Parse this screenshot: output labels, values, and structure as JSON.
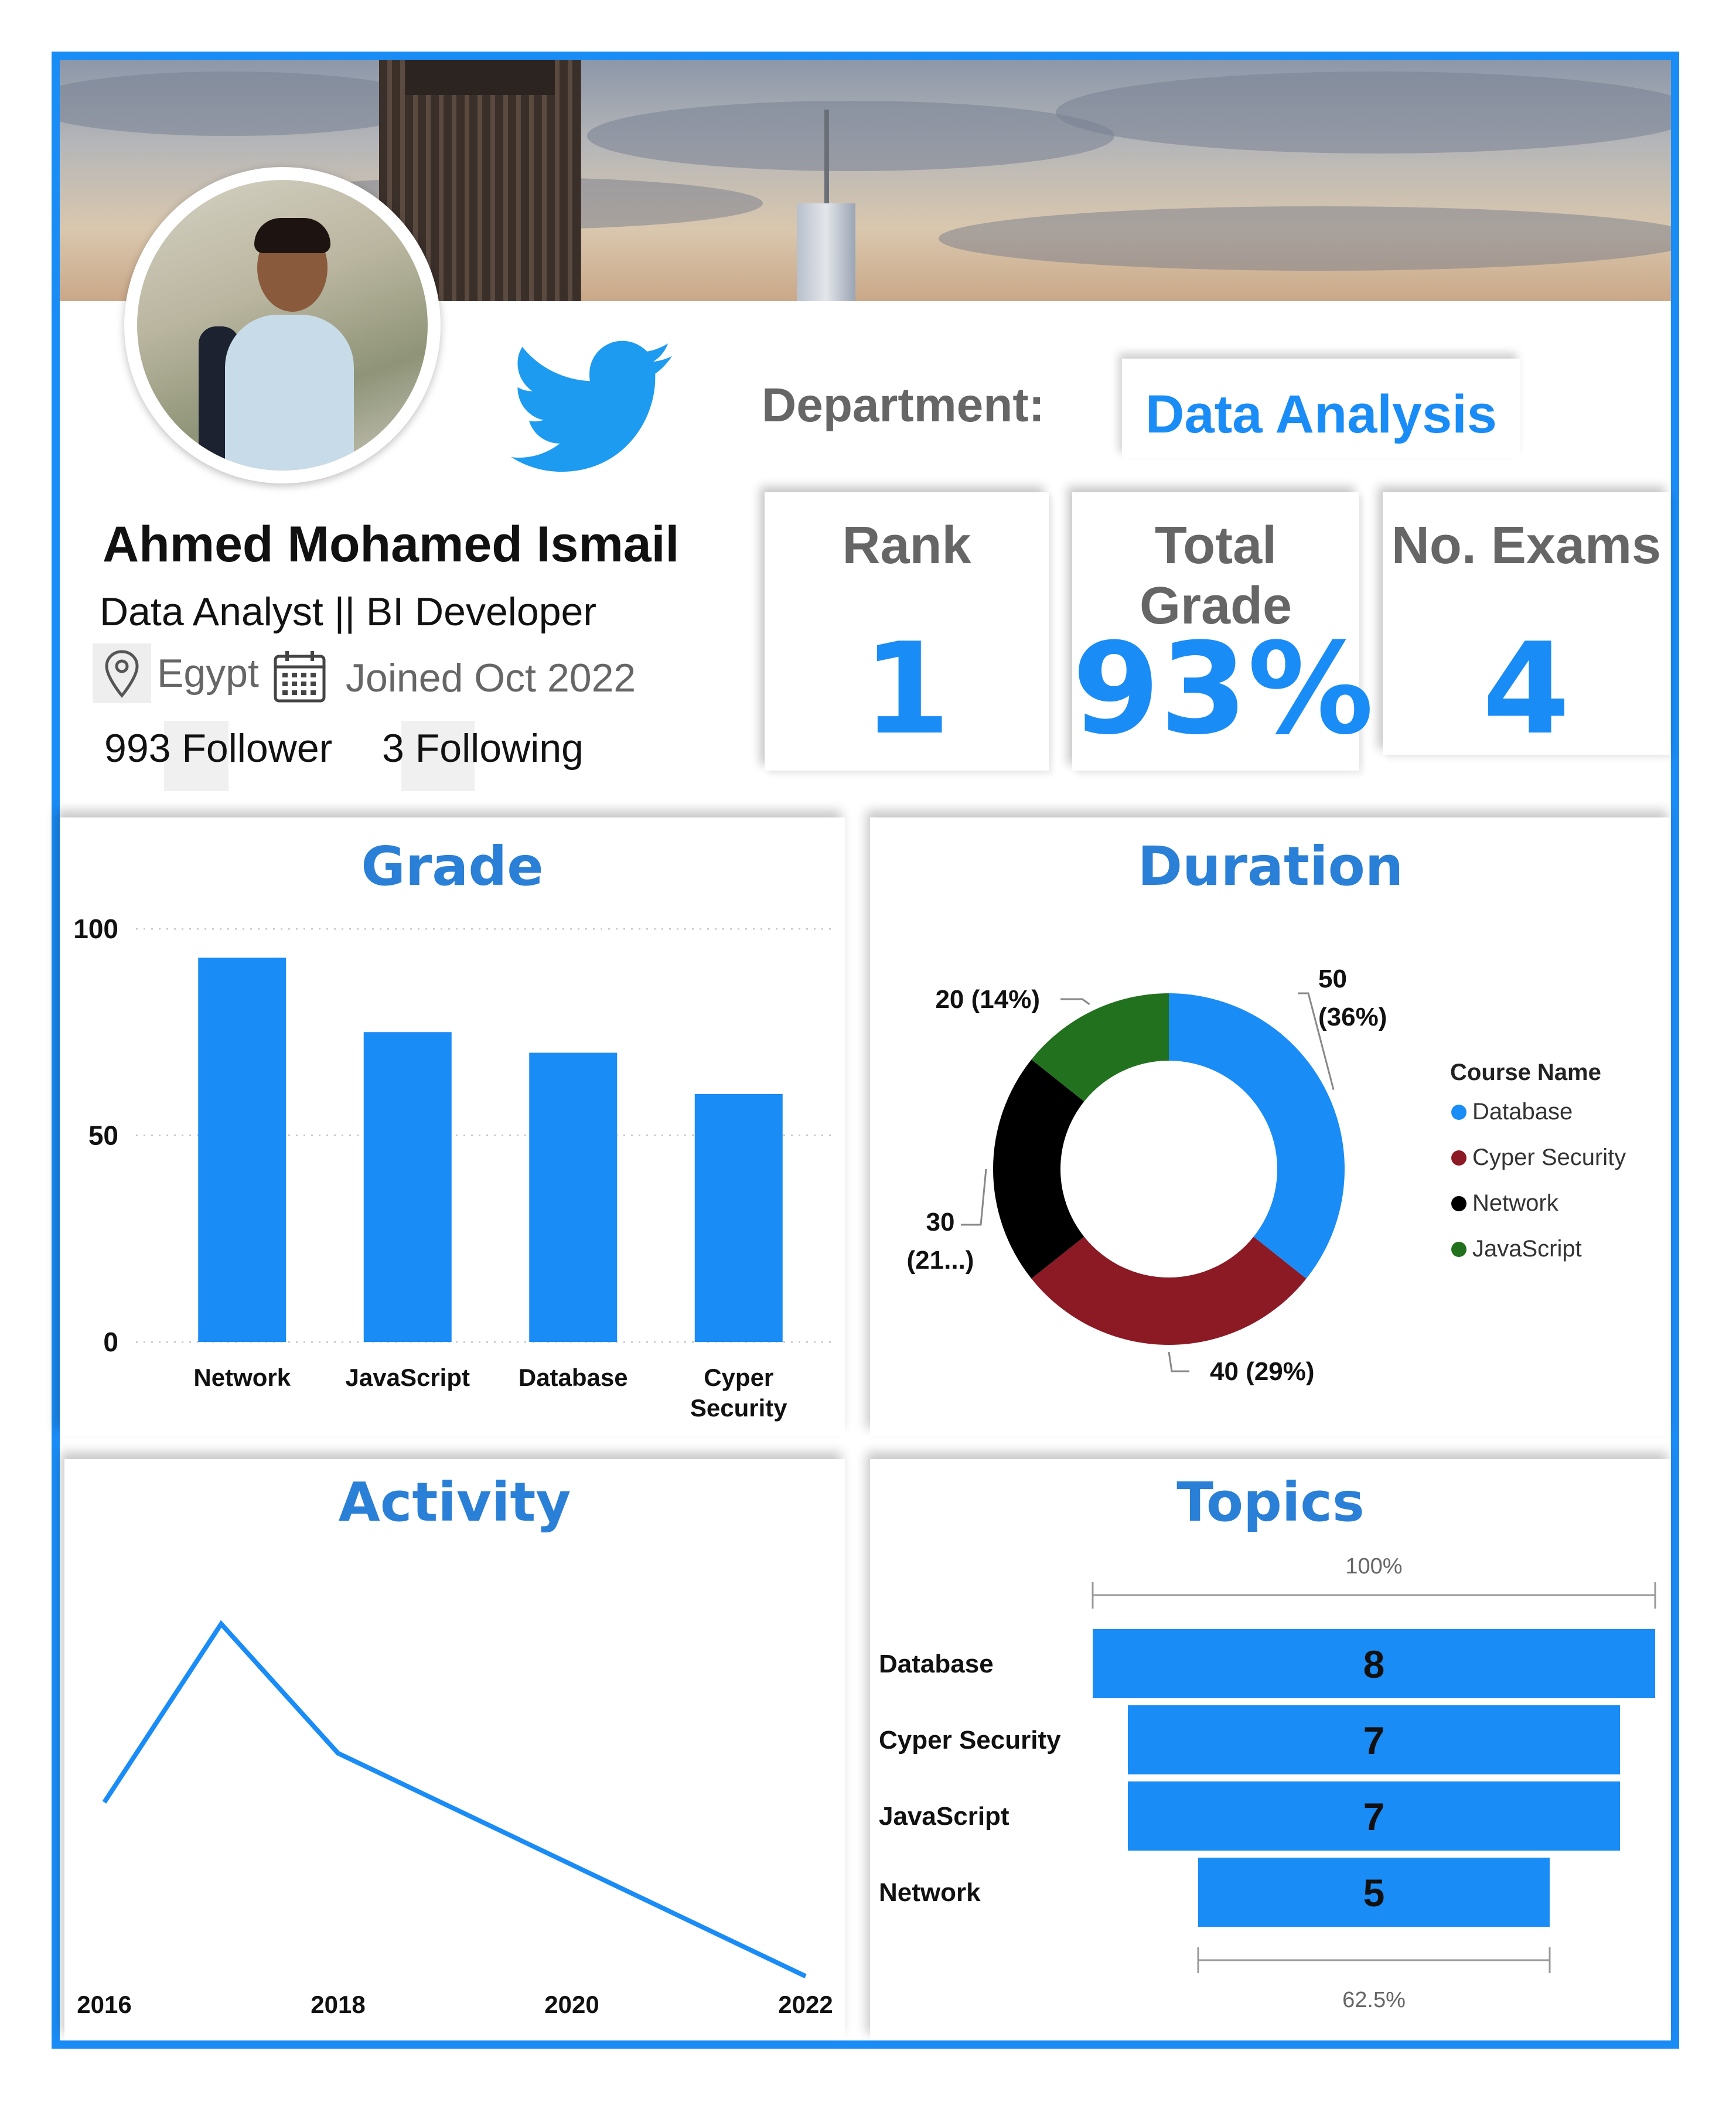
{
  "profile": {
    "name": "Ahmed Mohamed Ismail",
    "role": "Data Analyst || BI Developer",
    "location": "Egypt",
    "joined": "Joined Oct  2022",
    "followers": "993 Follower",
    "following": "3 Following"
  },
  "department": {
    "label": "Department:",
    "value": "Data Analysis"
  },
  "kpis": [
    {
      "label": "Rank",
      "value": "1"
    },
    {
      "label": "Total Grade",
      "value": "93%"
    },
    {
      "label": "No. Exams",
      "value": "4"
    }
  ],
  "colors": {
    "accent": "#1a8cf6",
    "title": "#2a7fd6",
    "maroon": "#8b1a25",
    "black": "#000000",
    "green": "#22711f"
  },
  "panels": {
    "grade": "Grade",
    "duration": "Duration",
    "activity": "Activity",
    "topics": "Topics"
  },
  "chart_data": [
    {
      "type": "bar",
      "title": "Grade",
      "categories": [
        "Network",
        "JavaScript",
        "Database",
        "Cyper Security"
      ],
      "values": [
        93,
        75,
        70,
        60
      ],
      "ylim": [
        0,
        100
      ],
      "yticks": [
        "0",
        "50",
        "100"
      ],
      "grid": true
    },
    {
      "type": "pie",
      "title": "Duration",
      "legend_title": "Course Name",
      "legend_position": "right",
      "slices": [
        {
          "name": "Database",
          "value": 50,
          "label": "50 (36%)",
          "color": "#1a8cf6"
        },
        {
          "name": "Cyper Security",
          "value": 40,
          "label": "40 (29%)",
          "color": "#8b1a25"
        },
        {
          "name": "Network",
          "value": 30,
          "label": "30 (21...)",
          "color": "#000000"
        },
        {
          "name": "JavaScript",
          "value": 20,
          "label": "20 (14%)",
          "color": "#22711f"
        }
      ]
    },
    {
      "type": "line",
      "title": "Activity",
      "x": [
        2016,
        2017,
        2018,
        2022
      ],
      "values": [
        4,
        8,
        5.1,
        0.1
      ],
      "xticks": [
        "2016",
        "2018",
        "2020",
        "2022"
      ],
      "xlim": [
        2016,
        2022
      ],
      "ylim": [
        0,
        9
      ]
    },
    {
      "type": "bar",
      "title": "Topics",
      "categories": [
        "Database",
        "Cyper Security",
        "JavaScript",
        "Network"
      ],
      "values": [
        8,
        7,
        7,
        5
      ],
      "top_label": "100%",
      "bottom_label": "62.5%"
    }
  ]
}
